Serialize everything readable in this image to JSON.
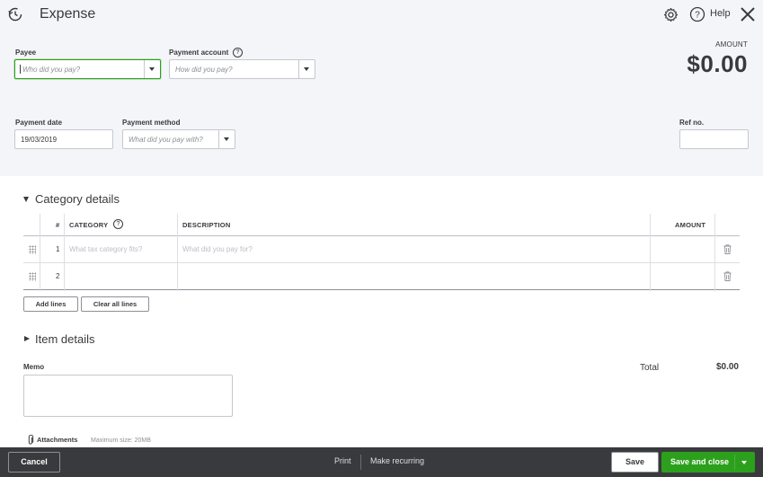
{
  "header": {
    "title": "Expense",
    "help_label": "Help"
  },
  "amount": {
    "label": "AMOUNT",
    "value": "$0.00"
  },
  "form": {
    "payee": {
      "label": "Payee",
      "placeholder": "Who did you pay?"
    },
    "payment_account": {
      "label": "Payment account",
      "placeholder": "How did you pay?"
    },
    "payment_date": {
      "label": "Payment date",
      "value": "19/03/2019"
    },
    "payment_method": {
      "label": "Payment method",
      "placeholder": "What did you pay with?"
    },
    "ref_no": {
      "label": "Ref no.",
      "value": ""
    }
  },
  "category_details": {
    "title": "Category details",
    "columns": {
      "num": "#",
      "category": "CATEGORY",
      "description": "DESCRIPTION",
      "amount": "AMOUNT"
    },
    "rows": [
      {
        "num": "1",
        "category_placeholder": "What tax category fits?",
        "description_placeholder": "What did you pay for?"
      },
      {
        "num": "2",
        "category_placeholder": "",
        "description_placeholder": ""
      }
    ],
    "add_lines": "Add lines",
    "clear_all_lines": "Clear all lines"
  },
  "item_details": {
    "title": "Item details"
  },
  "memo": {
    "label": "Memo",
    "value": ""
  },
  "totals": {
    "label": "Total",
    "value": "$0.00"
  },
  "attachments": {
    "label": "Attachments",
    "max_size": "Maximum size: 20MB"
  },
  "footer": {
    "cancel": "Cancel",
    "print": "Print",
    "make_recurring": "Make recurring",
    "save": "Save",
    "save_and_close": "Save and close"
  },
  "colors": {
    "brand_green": "#2ca01c",
    "footer_bg": "#393a3d",
    "header_bg": "#f4f5f8"
  },
  "icons": [
    "recent-transactions-icon",
    "gear-icon",
    "help-icon",
    "close-icon",
    "question-icon",
    "drag-handle-icon",
    "trash-icon",
    "paperclip-icon",
    "chevron-down-icon",
    "caret-right-icon"
  ]
}
